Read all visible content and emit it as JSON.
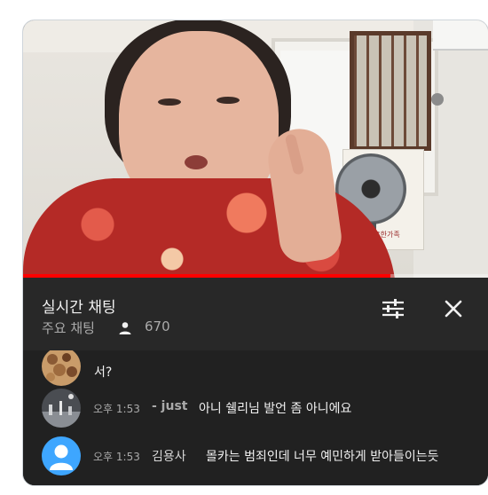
{
  "chat": {
    "title": "실시간 채팅",
    "mode_label": "주요 채팅",
    "viewer_count": "670",
    "progress": 0.79,
    "icons": {
      "viewers": "person-icon",
      "filter": "tune-sliders-icon",
      "close": "close-x-icon"
    }
  },
  "messages": [
    {
      "author": "",
      "time": "",
      "text": "서?"
    },
    {
      "author": "- just",
      "time": "오후 1:53",
      "text": "아니 쉘리님 발언 좀 아니에요"
    },
    {
      "author": "김용사",
      "time": "오후 1:53",
      "text": "몰카는 범죄인데 너무 예민하게 받아들이는듯"
    }
  ],
  "video": {
    "calendar_text": "르한가족"
  },
  "colors": {
    "header_bg": "#282828",
    "chat_bg": "#212121",
    "progress": "#ff0000",
    "default_avatar": "#3ea6ff"
  }
}
